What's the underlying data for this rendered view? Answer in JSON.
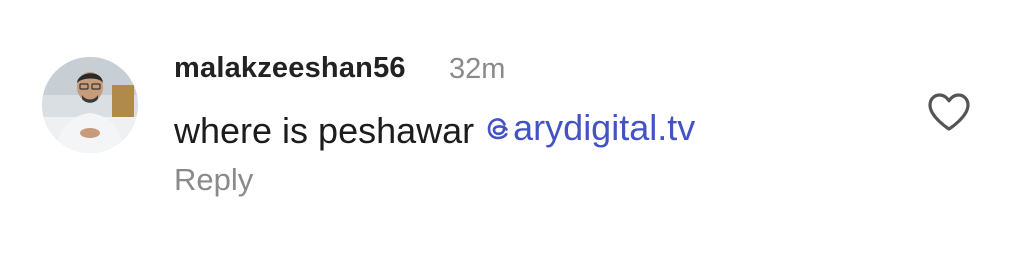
{
  "comment": {
    "username": "malakzeeshan56",
    "timestamp": "32m",
    "text": "where is peshawar ",
    "mention": "arydigital.tv",
    "reply_label": "Reply"
  },
  "icons": {
    "avatar": "profile-photo",
    "mention_prefix": "threads-at-icon",
    "like": "heart-outline-icon"
  },
  "colors": {
    "mention": "#4453c4",
    "secondary_text": "#8a8a8a",
    "primary_text": "#1c1c1c"
  }
}
